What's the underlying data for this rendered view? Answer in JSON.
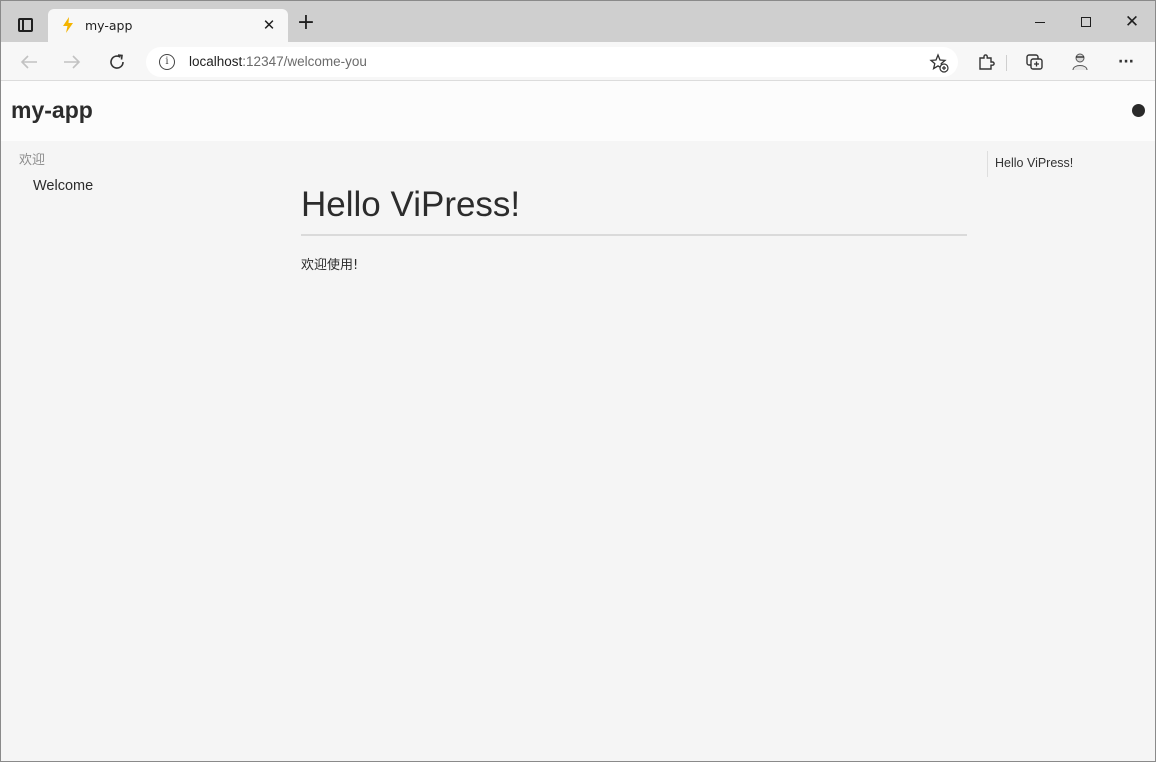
{
  "browser": {
    "tab": {
      "title": "my-app",
      "favicon": "lightning-bolt-icon",
      "favicon_color": "#f4b400"
    },
    "address": {
      "host": "localhost",
      "path": ":12347/welcome-you"
    },
    "icons": {
      "tab_actions": "tab-actions-icon",
      "close_tab": "close-icon",
      "new_tab": "plus-icon",
      "back": "arrow-left-icon",
      "forward": "arrow-right-icon",
      "reload": "reload-icon",
      "site_info": "info-icon",
      "favorites": "star-plus-icon",
      "extensions": "puzzle-icon",
      "collections": "collections-icon",
      "profile": "avatar",
      "more": "ellipsis-icon"
    },
    "glyphs": {
      "close": "✕",
      "plus": "+",
      "info": "i",
      "more": "···"
    }
  },
  "app": {
    "title": "my-app",
    "sidebar": {
      "group": "欢迎",
      "items": [
        {
          "label": "Welcome"
        }
      ]
    },
    "content": {
      "heading": "Hello ViPress!",
      "paragraph": "欢迎使用!"
    },
    "toc": {
      "items": [
        {
          "label": "Hello ViPress!"
        }
      ]
    }
  },
  "colors": {
    "page_bg": "#f5f5f5",
    "header_bg": "#fcfcfc",
    "text": "#2c2c2c",
    "muted": "#8d8d8d"
  }
}
